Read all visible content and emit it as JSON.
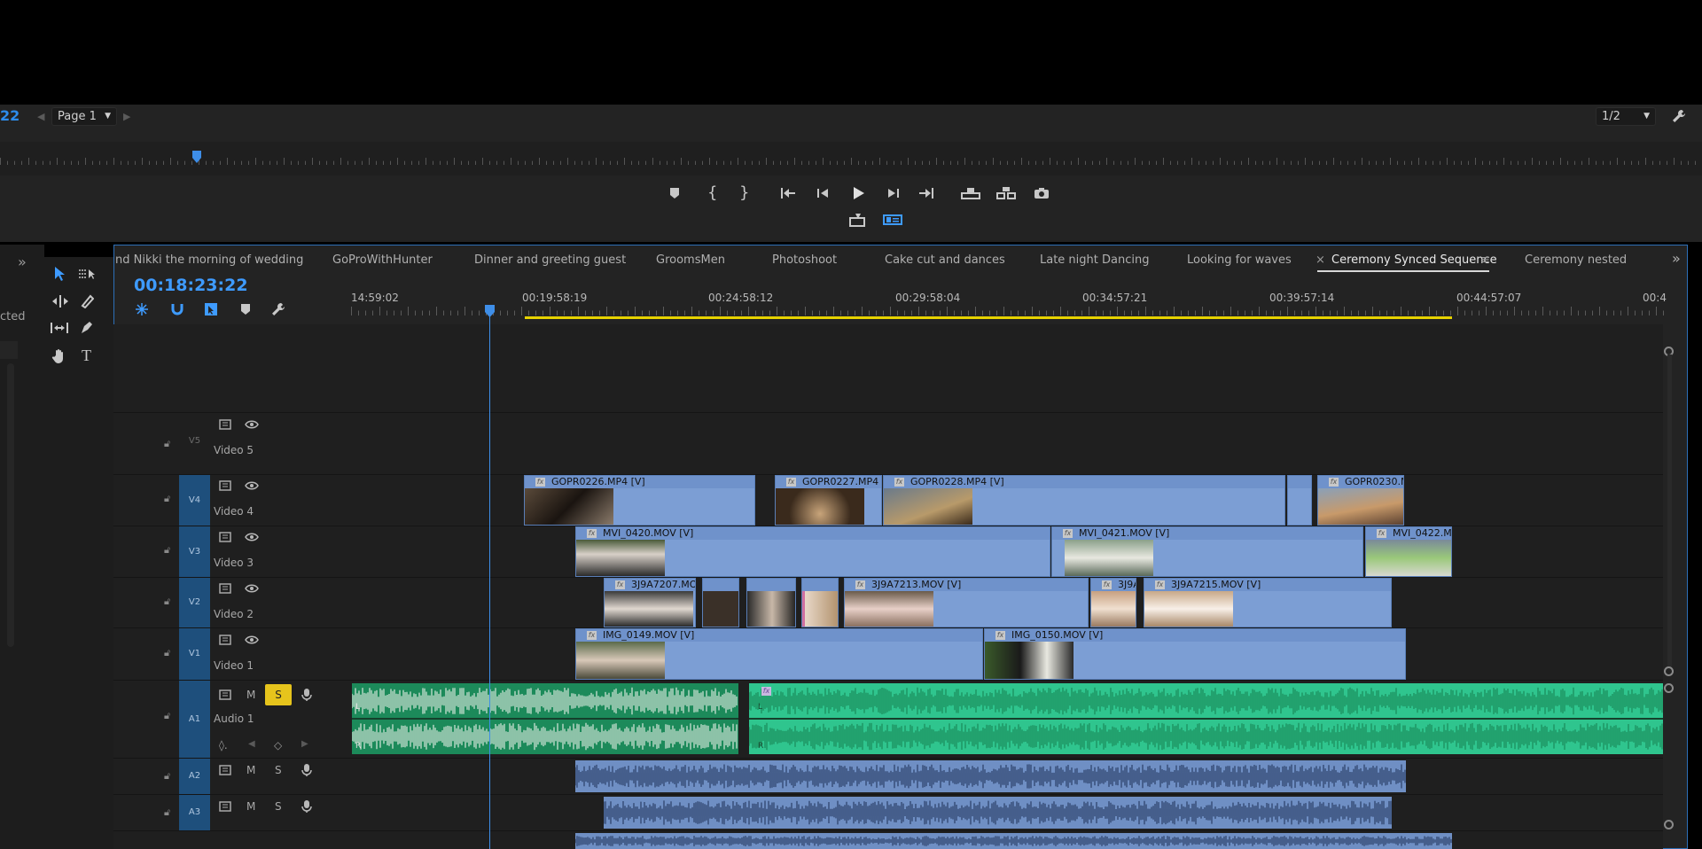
{
  "program_monitor": {
    "timecode_fragment": "22",
    "page_label": "Page 1",
    "zoom_label": "1/2"
  },
  "transport_icons": [
    "marker-icon",
    "mark-in-icon",
    "mark-out-icon",
    "go-to-in-icon",
    "step-back-icon",
    "play-icon",
    "step-forward-icon",
    "go-to-out-icon",
    "lift-icon",
    "extract-icon",
    "export-frame-icon",
    "insert-icon",
    "overlay-icon"
  ],
  "left_panel": {
    "partial_text": "cted"
  },
  "tabs": [
    {
      "label": "nd Nikki the morning of wedding"
    },
    {
      "label": "GoProWithHunter"
    },
    {
      "label": "Dinner and greeting guest"
    },
    {
      "label": "GroomsMen"
    },
    {
      "label": "Photoshoot"
    },
    {
      "label": "Cake cut and dances"
    },
    {
      "label": "Late night Dancing"
    },
    {
      "label": "Looking for waves"
    },
    {
      "label": "Ceremony Synced Sequence",
      "active": true
    },
    {
      "label": "Ceremony nested"
    }
  ],
  "tab_close": "×",
  "tab_menu": "≡",
  "sequence": {
    "timecode": "00:18:23:22",
    "ruler_labels": [
      "14:59:02",
      "00:19:58:19",
      "00:24:58:12",
      "00:29:58:04",
      "00:34:57:21",
      "00:39:57:14",
      "00:44:57:07",
      "00:4"
    ]
  },
  "tracks": {
    "video": [
      {
        "id": "V5",
        "name": "Video 5"
      },
      {
        "id": "V4",
        "name": "Video 4"
      },
      {
        "id": "V3",
        "name": "Video 3"
      },
      {
        "id": "V2",
        "name": "Video 2"
      },
      {
        "id": "V1",
        "name": "Video 1"
      }
    ],
    "audio": [
      {
        "id": "A1",
        "name": "Audio 1",
        "mute": "M",
        "solo": "S"
      },
      {
        "id": "A2",
        "mute": "M",
        "solo": "S"
      },
      {
        "id": "A3",
        "mute": "M",
        "solo": "S"
      }
    ]
  },
  "clips": {
    "v4": [
      "GOPR0226.MP4 [V]",
      "GOPR0227.MP4 [V]",
      "GOPR0228.MP4 [V]",
      "GOPR0230.M"
    ],
    "v3": [
      "MVI_0420.MOV [V]",
      "MVI_0421.MOV [V]",
      "MVI_0422.MC"
    ],
    "v2": [
      "3J9A7207.MOV",
      "3J9A7213.MOV [V]",
      "3J9A",
      "3J9A7215.MOV [V]"
    ],
    "v1": [
      "IMG_0149.MOV [V]",
      "IMG_0150.MOV [V]"
    ]
  },
  "audio_channel_labels": {
    "left": "L",
    "right": "R"
  },
  "fx_badge": "fx",
  "colors": {
    "accent_blue": "#3e9bff",
    "video_clip": "#7c9ed4",
    "audio_clip_green": "#2fc58e",
    "audio_clip_dark": "#1c8a5a",
    "work_area": "#e6d200",
    "solo_yellow": "#e6c41c"
  }
}
